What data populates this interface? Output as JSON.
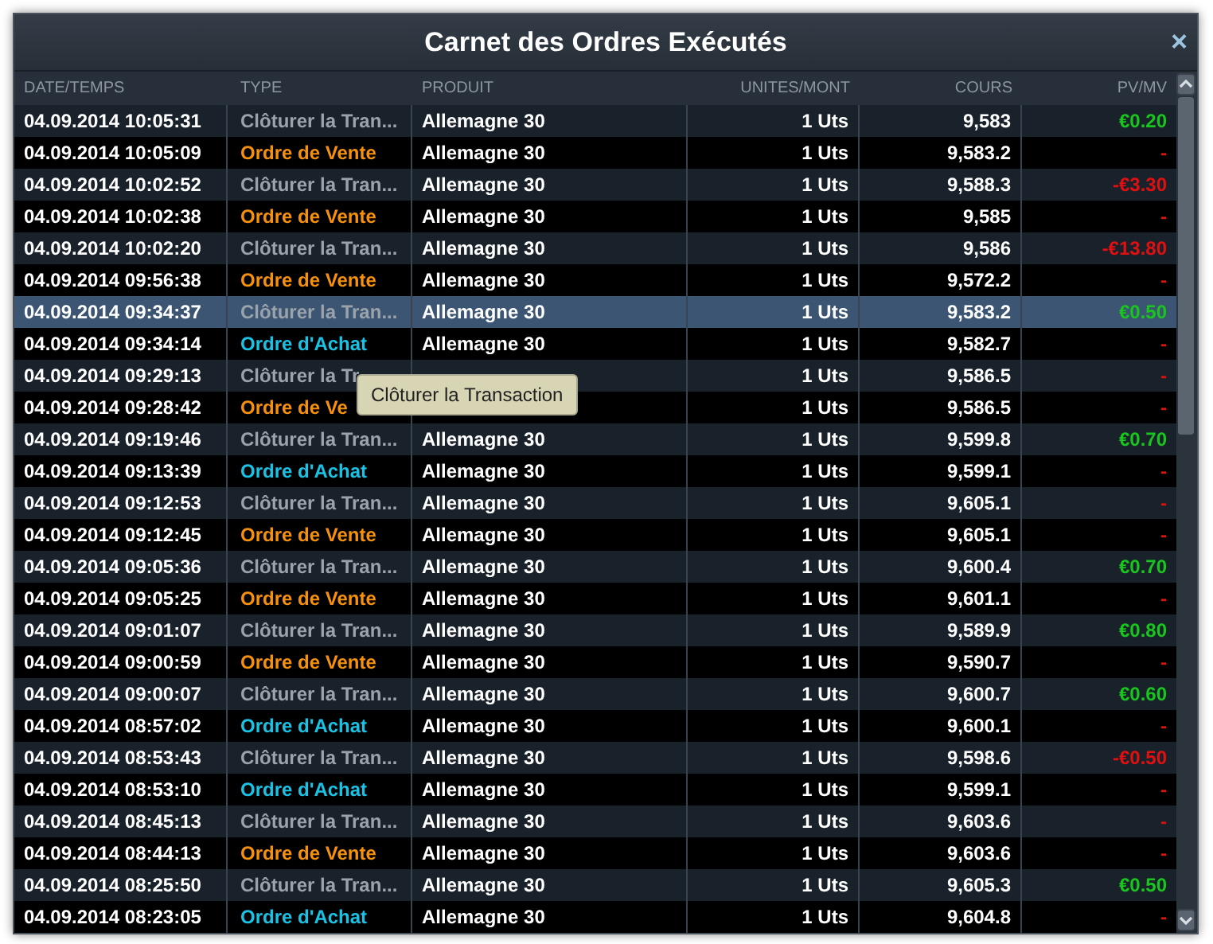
{
  "window": {
    "title": "Carnet des Ordres Exécutés",
    "close": "×"
  },
  "table": {
    "columns": [
      "DATE/TEMPS",
      "TYPE",
      "PRODUIT",
      "UNITES/MONT",
      "COURS",
      "PV/MV"
    ],
    "rows": [
      {
        "date": "04.09.2014 10:05:31",
        "type": "Clôturer la Tran...",
        "kind": "close",
        "product": "Allemagne 30",
        "units": "1 Uts",
        "price": "9,583",
        "pv": "€0.20",
        "gain": true,
        "selected": false
      },
      {
        "date": "04.09.2014 10:05:09",
        "type": "Ordre de Vente",
        "kind": "sell",
        "product": "Allemagne 30",
        "units": "1 Uts",
        "price": "9,583.2",
        "pv": "-",
        "gain": false,
        "selected": false
      },
      {
        "date": "04.09.2014 10:02:52",
        "type": "Clôturer la Tran...",
        "kind": "close",
        "product": "Allemagne 30",
        "units": "1 Uts",
        "price": "9,588.3",
        "pv": "-€3.30",
        "gain": false,
        "selected": false
      },
      {
        "date": "04.09.2014 10:02:38",
        "type": "Ordre de Vente",
        "kind": "sell",
        "product": "Allemagne 30",
        "units": "1 Uts",
        "price": "9,585",
        "pv": "-",
        "gain": false,
        "selected": false
      },
      {
        "date": "04.09.2014 10:02:20",
        "type": "Clôturer la Tran...",
        "kind": "close",
        "product": "Allemagne 30",
        "units": "1 Uts",
        "price": "9,586",
        "pv": "-€13.80",
        "gain": false,
        "selected": false
      },
      {
        "date": "04.09.2014 09:56:38",
        "type": "Ordre de Vente",
        "kind": "sell",
        "product": "Allemagne 30",
        "units": "1 Uts",
        "price": "9,572.2",
        "pv": "-",
        "gain": false,
        "selected": false
      },
      {
        "date": "04.09.2014 09:34:37",
        "type": "Clôturer la Tran...",
        "kind": "close",
        "product": "Allemagne 30",
        "units": "1 Uts",
        "price": "9,583.2",
        "pv": "€0.50",
        "gain": true,
        "selected": true
      },
      {
        "date": "04.09.2014 09:34:14",
        "type": "Ordre d'Achat",
        "kind": "buy",
        "product": "Allemagne 30",
        "units": "1 Uts",
        "price": "9,582.7",
        "pv": "-",
        "gain": false,
        "selected": false
      },
      {
        "date": "04.09.2014 09:29:13",
        "type": "Clôturer la Tr",
        "kind": "close",
        "units": "1 Uts",
        "price": "9,586.5",
        "pv": "-",
        "gain": false,
        "selected": false
      },
      {
        "date": "04.09.2014 09:28:42",
        "type": "Ordre de Ve",
        "kind": "sell",
        "units": "1 Uts",
        "price": "9,586.5",
        "pv": "-",
        "gain": false,
        "selected": false
      },
      {
        "date": "04.09.2014 09:19:46",
        "type": "Clôturer la Tran...",
        "kind": "close",
        "product": "Allemagne 30",
        "units": "1 Uts",
        "price": "9,599.8",
        "pv": "€0.70",
        "gain": true,
        "selected": false
      },
      {
        "date": "04.09.2014 09:13:39",
        "type": "Ordre d'Achat",
        "kind": "buy",
        "product": "Allemagne 30",
        "units": "1 Uts",
        "price": "9,599.1",
        "pv": "-",
        "gain": false,
        "selected": false
      },
      {
        "date": "04.09.2014 09:12:53",
        "type": "Clôturer la Tran...",
        "kind": "close",
        "product": "Allemagne 30",
        "units": "1 Uts",
        "price": "9,605.1",
        "pv": "-",
        "gain": false,
        "selected": false
      },
      {
        "date": "04.09.2014 09:12:45",
        "type": "Ordre de Vente",
        "kind": "sell",
        "product": "Allemagne 30",
        "units": "1 Uts",
        "price": "9,605.1",
        "pv": "-",
        "gain": false,
        "selected": false
      },
      {
        "date": "04.09.2014 09:05:36",
        "type": "Clôturer la Tran...",
        "kind": "close",
        "product": "Allemagne 30",
        "units": "1 Uts",
        "price": "9,600.4",
        "pv": "€0.70",
        "gain": true,
        "selected": false
      },
      {
        "date": "04.09.2014 09:05:25",
        "type": "Ordre de Vente",
        "kind": "sell",
        "product": "Allemagne 30",
        "units": "1 Uts",
        "price": "9,601.1",
        "pv": "-",
        "gain": false,
        "selected": false
      },
      {
        "date": "04.09.2014 09:01:07",
        "type": "Clôturer la Tran...",
        "kind": "close",
        "product": "Allemagne 30",
        "units": "1 Uts",
        "price": "9,589.9",
        "pv": "€0.80",
        "gain": true,
        "selected": false
      },
      {
        "date": "04.09.2014 09:00:59",
        "type": "Ordre de Vente",
        "kind": "sell",
        "product": "Allemagne 30",
        "units": "1 Uts",
        "price": "9,590.7",
        "pv": "-",
        "gain": false,
        "selected": false
      },
      {
        "date": "04.09.2014 09:00:07",
        "type": "Clôturer la Tran...",
        "kind": "close",
        "product": "Allemagne 30",
        "units": "1 Uts",
        "price": "9,600.7",
        "pv": "€0.60",
        "gain": true,
        "selected": false
      },
      {
        "date": "04.09.2014 08:57:02",
        "type": "Ordre d'Achat",
        "kind": "buy",
        "product": "Allemagne 30",
        "units": "1 Uts",
        "price": "9,600.1",
        "pv": "-",
        "gain": false,
        "selected": false
      },
      {
        "date": "04.09.2014 08:53:43",
        "type": "Clôturer la Tran...",
        "kind": "close",
        "product": "Allemagne 30",
        "units": "1 Uts",
        "price": "9,598.6",
        "pv": "-€0.50",
        "gain": false,
        "selected": false
      },
      {
        "date": "04.09.2014 08:53:10",
        "type": "Ordre d'Achat",
        "kind": "buy",
        "product": "Allemagne 30",
        "units": "1 Uts",
        "price": "9,599.1",
        "pv": "-",
        "gain": false,
        "selected": false
      },
      {
        "date": "04.09.2014 08:45:13",
        "type": "Clôturer la Tran...",
        "kind": "close",
        "product": "Allemagne 30",
        "units": "1 Uts",
        "price": "9,603.6",
        "pv": "-",
        "gain": false,
        "selected": false
      },
      {
        "date": "04.09.2014 08:44:13",
        "type": "Ordre de Vente",
        "kind": "sell",
        "product": "Allemagne 30",
        "units": "1 Uts",
        "price": "9,603.6",
        "pv": "-",
        "gain": false,
        "selected": false
      },
      {
        "date": "04.09.2014 08:25:50",
        "type": "Clôturer la Tran...",
        "kind": "close",
        "product": "Allemagne 30",
        "units": "1 Uts",
        "price": "9,605.3",
        "pv": "€0.50",
        "gain": true,
        "selected": false
      },
      {
        "date": "04.09.2014 08:23:05",
        "type": "Ordre d'Achat",
        "kind": "buy",
        "product": "Allemagne 30",
        "units": "1 Uts",
        "price": "9,604.8",
        "pv": "-",
        "gain": false,
        "selected": false
      }
    ]
  },
  "tooltip": {
    "text": "Clôturer la Transaction"
  }
}
